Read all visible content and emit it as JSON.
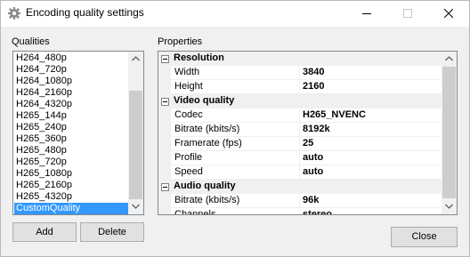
{
  "window": {
    "title": "Encoding quality settings",
    "controls": [
      "minimize-icon",
      "maximize-icon",
      "close-icon"
    ]
  },
  "qualities": {
    "label": "Qualities",
    "items": [
      "H264_480p",
      "H264_720p",
      "H264_1080p",
      "H264_2160p",
      "H264_4320p",
      "H265_144p",
      "H265_240p",
      "H265_360p",
      "H265_480p",
      "H265_720p",
      "H265_1080p",
      "H265_2160p",
      "H265_4320p",
      "CustomQuality"
    ],
    "selected": "CustomQuality",
    "add_label": "Add",
    "delete_label": "Delete"
  },
  "properties": {
    "label": "Properties",
    "categories": [
      {
        "name": "Resolution",
        "rows": [
          {
            "name": "Width",
            "value": "3840"
          },
          {
            "name": "Height",
            "value": "2160"
          }
        ]
      },
      {
        "name": "Video quality",
        "rows": [
          {
            "name": "Codec",
            "value": "H265_NVENC"
          },
          {
            "name": "Bitrate (kbits/s)",
            "value": "8192k"
          },
          {
            "name": "Framerate (fps)",
            "value": "25"
          },
          {
            "name": "Profile",
            "value": "auto"
          },
          {
            "name": "Speed",
            "value": "auto"
          }
        ]
      },
      {
        "name": "Audio quality",
        "rows": [
          {
            "name": "Bitrate (kbits/s)",
            "value": "96k"
          },
          {
            "name": "Channels",
            "value": "stereo"
          }
        ]
      }
    ]
  },
  "footer": {
    "close_label": "Close"
  }
}
